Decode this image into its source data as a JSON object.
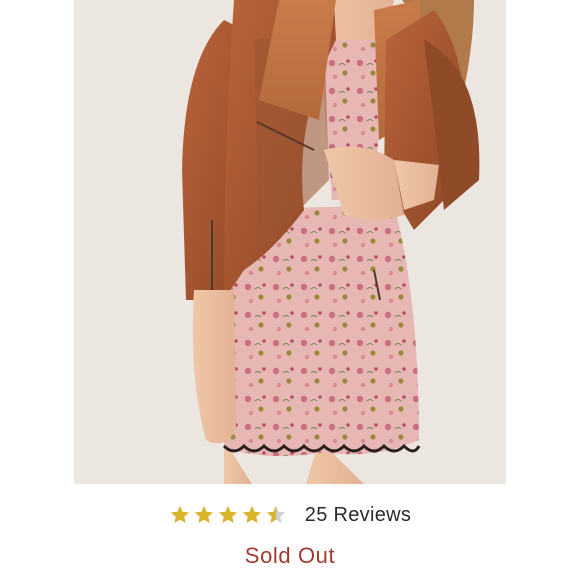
{
  "product": {
    "image_description_icon": "product-photo",
    "rating": {
      "value": 4.5,
      "max": 5,
      "reviews_label": "25 Reviews",
      "star_color": "#d9b32c",
      "empty_star_color": "#cfcfd6"
    },
    "status": {
      "label": "Sold Out",
      "color": "#a23a32"
    }
  }
}
